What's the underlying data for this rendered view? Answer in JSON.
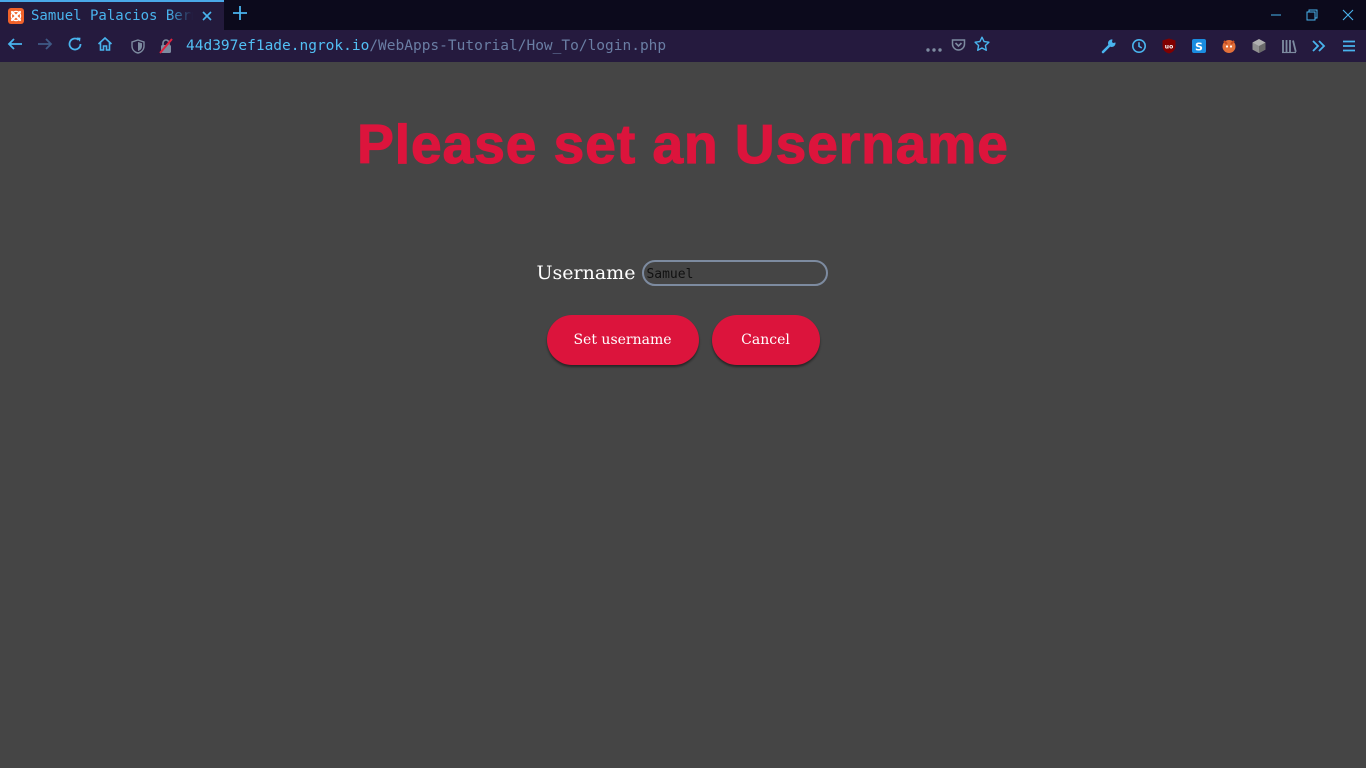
{
  "browser": {
    "tab_title": "Samuel Palacios Bermudez - How To",
    "url_domain": "44d397ef1ade.ngrok.io",
    "url_path": "/WebApps-Tutorial/How_To/login.php"
  },
  "page": {
    "heading": "Please set an Username",
    "username_label": "Username",
    "username_value": "Samuel",
    "set_button_label": "Set username",
    "cancel_button_label": "Cancel"
  },
  "colors": {
    "accent": "#dc143c",
    "page_background": "#454545",
    "tabbar_background": "#0c0a1c",
    "navbar_background": "#251a3e",
    "url_domain": "#52c0f5",
    "url_path": "#6a7ea4"
  },
  "icons": {
    "tab_favicon": "xampp-icon",
    "tab_close": "close-icon",
    "new_tab": "plus-icon",
    "back": "arrow-left-icon",
    "forward": "arrow-right-icon",
    "reload": "reload-icon",
    "home": "home-icon",
    "tracking": "shield-icon",
    "insecure": "insecure-lock-icon",
    "more": "ellipsis-icon",
    "pocket": "pocket-icon",
    "bookmark": "star-icon",
    "toolbar": [
      "wrench-icon",
      "history-icon",
      "ublock-icon",
      "s-extension-icon",
      "fox-extension-icon",
      "cube-extension-icon",
      "library-icon",
      "overflow-icon",
      "menu-icon"
    ]
  }
}
